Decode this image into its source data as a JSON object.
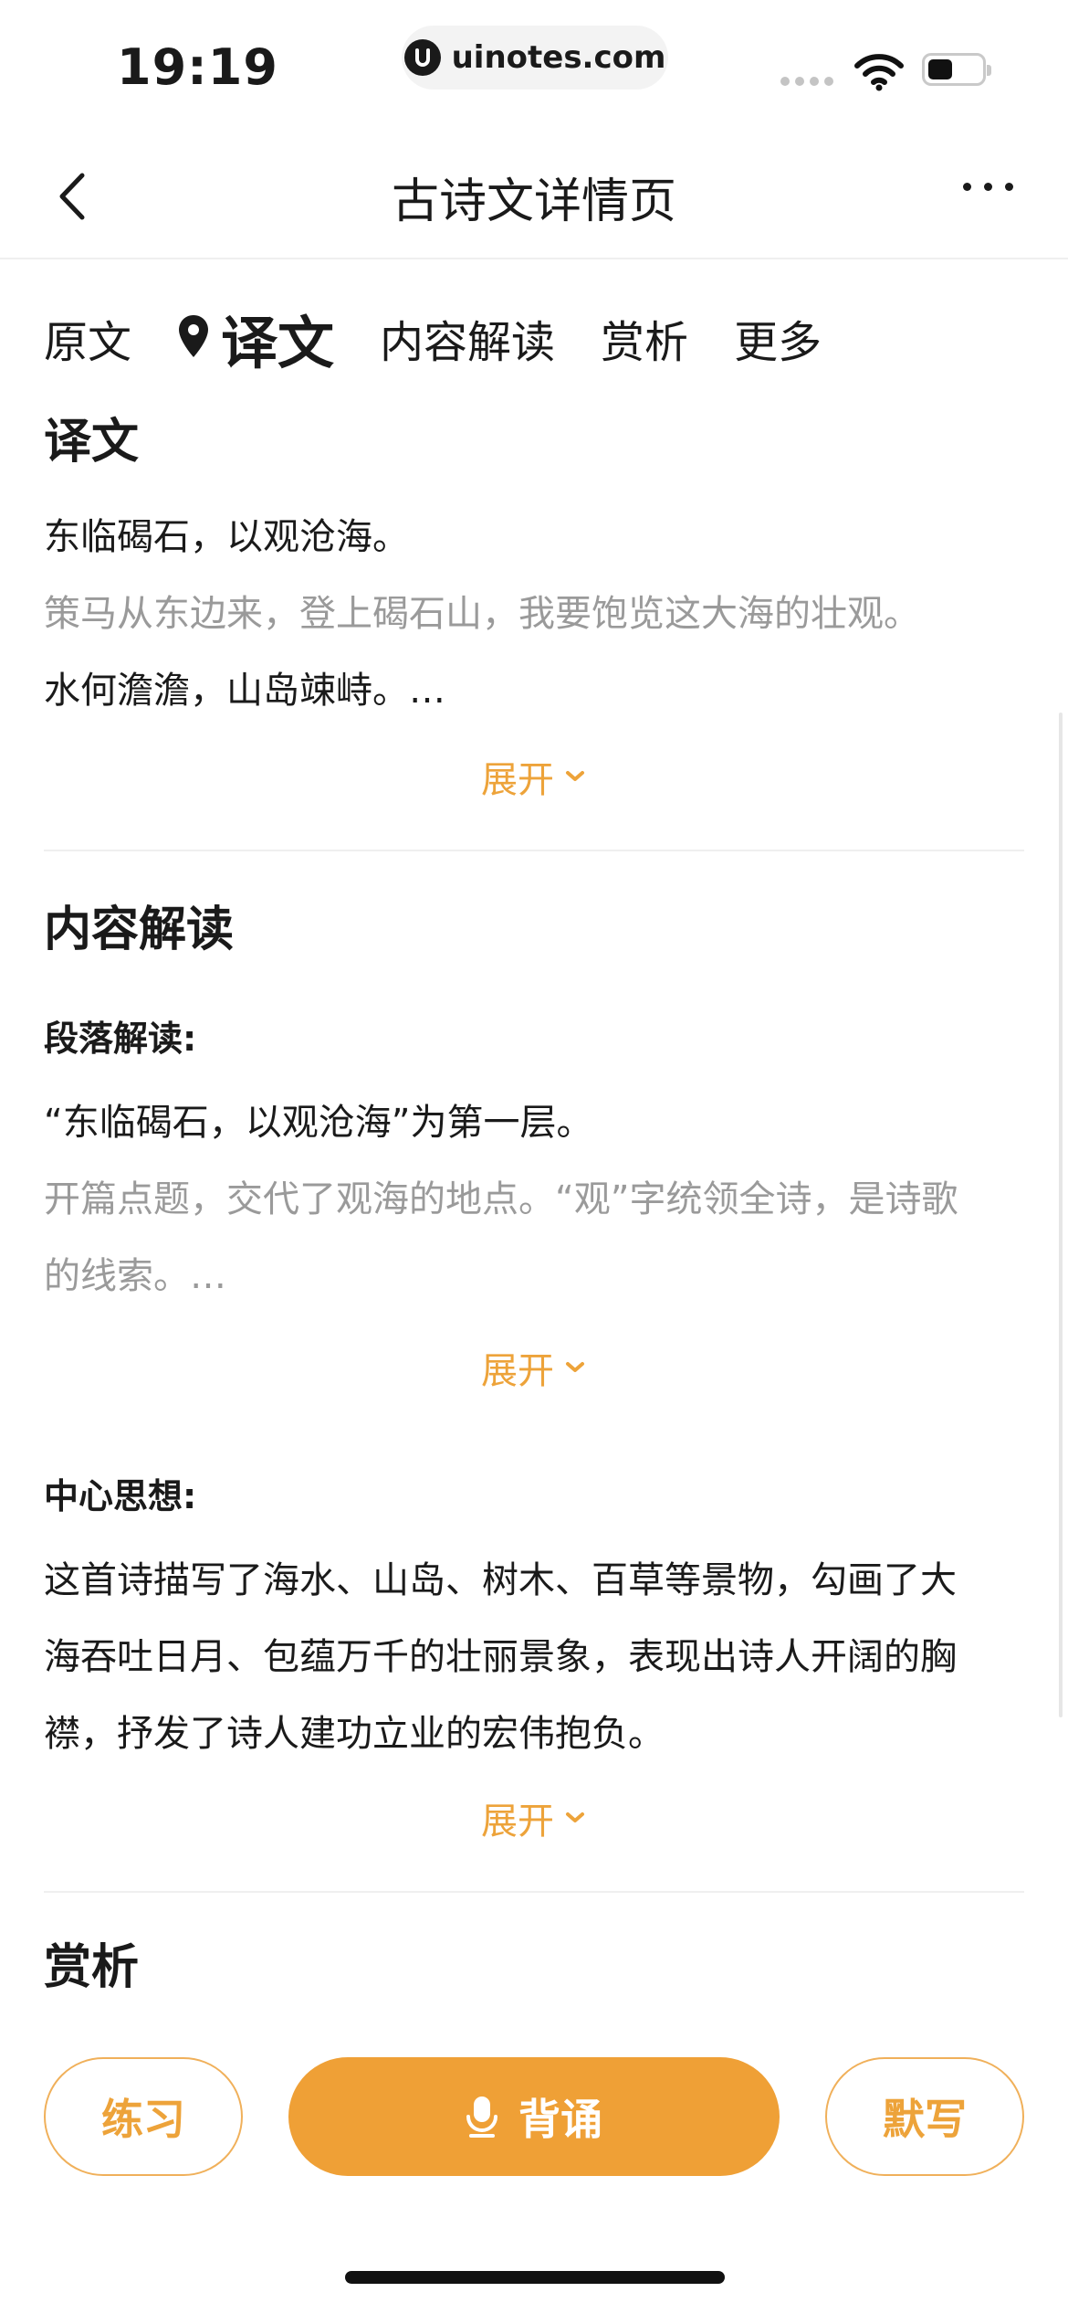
{
  "status_bar": {
    "time": "19:19",
    "url": "uinotes.com"
  },
  "nav": {
    "title": "古诗文详情页"
  },
  "tabs": [
    {
      "label": "原文"
    },
    {
      "label": "译文",
      "active": true
    },
    {
      "label": "内容解读"
    },
    {
      "label": "赏析"
    },
    {
      "label": "更多"
    }
  ],
  "translation": {
    "title": "译文",
    "line1": "东临碣石，以观沧海。",
    "line2": "策马从东边来，登上碣石山，我要饱览这大海的壮观。",
    "line3": "水何澹澹，山岛竦峙。…",
    "expand_label": "展开"
  },
  "interpretation": {
    "title": "内容解读",
    "paragraph": {
      "label": "段落解读:",
      "line1": "“东临碣石，以观沧海”为第一层。",
      "line2": "开篇点题，交代了观海的地点。“观”字统领全诗，是诗歌",
      "line3": "的线索。…",
      "expand_label": "展开"
    },
    "theme": {
      "label": "中心思想:",
      "line1": "这首诗描写了海水、山岛、树木、百草等景物，勾画了大",
      "line2": "海吞吐日月、包蕴万千的壮丽景象，表现出诗人开阔的胸",
      "line3": "襟，抒发了诗人建功立业的宏伟抱负。",
      "expand_label": "展开"
    }
  },
  "appreciation": {
    "title": "赏析"
  },
  "bottom_bar": {
    "practice_label": "练习",
    "recite_label": "背诵",
    "dictation_label": "默写"
  },
  "colors": {
    "accent": "#efa036",
    "accent_text": "#eda33a",
    "muted_text": "#9a9a9a"
  }
}
